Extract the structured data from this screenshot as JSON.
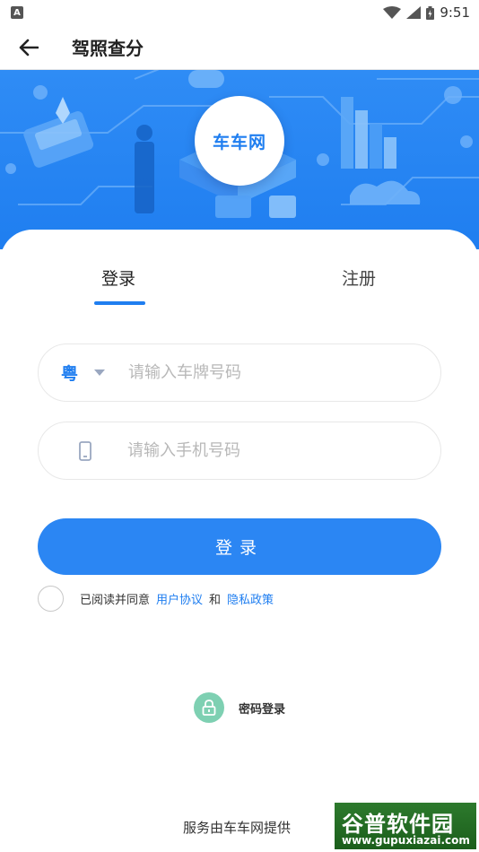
{
  "status_bar": {
    "notification_icon_letter": "A",
    "time": "9:51"
  },
  "app_bar": {
    "title": "驾照查分",
    "back_icon": "arrow-left-icon"
  },
  "banner": {
    "logo_text": "车车网",
    "background_color": "#2f8cf5"
  },
  "tabs": [
    {
      "label": "登录",
      "active": true
    },
    {
      "label": "注册",
      "active": false
    }
  ],
  "form": {
    "province": "粤",
    "plate_placeholder": "请输入车牌号码",
    "phone_placeholder": "请输入手机号码",
    "login_button": "登录"
  },
  "agreement": {
    "prefix": "已阅读并同意",
    "user_agreement": "用户协议",
    "conjunction": "和",
    "privacy_policy": "隐私政策"
  },
  "password_login": {
    "label": "密码登录",
    "icon": "lock-icon"
  },
  "footer": {
    "provider_text": "服务由车车网提供"
  },
  "watermark": {
    "name": "谷普软件园",
    "url": "www.gupuxiazai.com"
  },
  "colors": {
    "accent": "#1f7ef0",
    "button": "#2b86f3",
    "lock_green": "#7ed0b2"
  }
}
